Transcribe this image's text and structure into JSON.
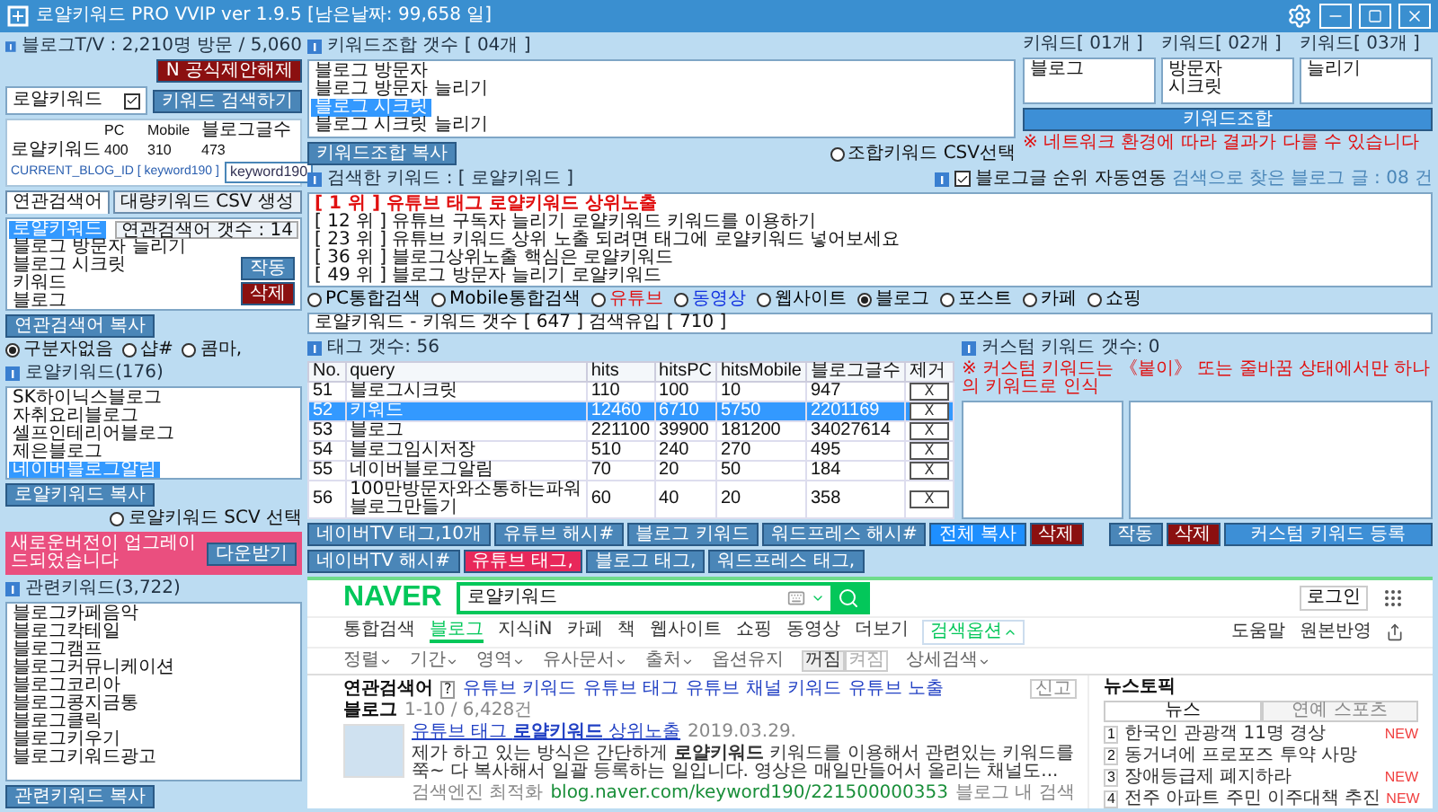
{
  "window": {
    "title": "로얄키워드 PRO VVIP ver 1.9.5 [남은날짜: 99,658 일]"
  },
  "blog_stats": {
    "label": "블로그T/V : 2,210명 방문 / 5,060",
    "button": "N 공식제안해제"
  },
  "search": {
    "value": "로얄키워드",
    "checked": true,
    "button": "키워드 검색하기"
  },
  "stats": {
    "columns": [
      "PC",
      "Mobile",
      "블로그글수"
    ],
    "keyword": "로얄키워드",
    "values": [
      "400",
      "310",
      "473"
    ],
    "blog_id_label": "CURRENT_BLOG_ID [ keyword190 ]",
    "blog_id_value": "keyword190"
  },
  "tabs": [
    {
      "label": "연관검색어",
      "selected": true
    },
    {
      "label": "대량키워드 CSV 생성",
      "selected": false
    }
  ],
  "related_list": {
    "count": "연관검색어 갯수 : 14",
    "items": [
      {
        "label": "로얄키워드",
        "selected": true
      },
      {
        "label": "블로그 방문자 늘리기",
        "selected": false
      },
      {
        "label": "블로그 시크릿",
        "selected": false
      },
      {
        "label": "키워드",
        "selected": false
      },
      {
        "label": "블로그",
        "selected": false
      }
    ],
    "run_button": "작동",
    "delete_button": "삭제",
    "copy_button": "연관검색어 복사",
    "separators": [
      {
        "label": "구분자없음",
        "selected": true
      },
      {
        "label": "샵#",
        "selected": false
      },
      {
        "label": "콤마,",
        "selected": false
      }
    ]
  },
  "royal": {
    "header": "로얄키워드(176)",
    "items": [
      {
        "label": "SK하이닉스블로그",
        "selected": false
      },
      {
        "label": "자취요리블로그",
        "selected": false
      },
      {
        "label": "셀프인테리어블로그",
        "selected": false
      },
      {
        "label": "제은블로그",
        "selected": false
      },
      {
        "label": "네이버블로그알림",
        "selected": true
      }
    ],
    "copy_button": "로얄키워드 복사",
    "csv_option": {
      "label": "로얄키워드 SCV 선택",
      "selected": false
    }
  },
  "banner": {
    "text": "새로운버전이 업그레이드되었습니다",
    "button": "다운받기"
  },
  "related_keywords": {
    "header": "관련키워드(3,722)",
    "items": [
      "블로그카페음악",
      "블로그칵테일",
      "블로그캠프",
      "블로그커뮤니케이션",
      "블로그코리아",
      "블로그콩지금통",
      "블로그클릭",
      "블로그키우기",
      "블로그키워드광고"
    ],
    "copy_button": "관련키워드 복사"
  },
  "combo": {
    "header": "키워드조합 갯수 [ 04개 ]",
    "items": [
      {
        "label": "블로그 방문자",
        "selected": false
      },
      {
        "label": "블로그 방문자 늘리기",
        "selected": false
      },
      {
        "label": "블로그 시크릿",
        "selected": true
      },
      {
        "label": "블로그 시크릿 늘리기",
        "selected": false
      }
    ],
    "copy_button": "키워드조합 복사",
    "csv_option": {
      "label": "조합키워드 CSV선택",
      "selected": false
    }
  },
  "keyword_lists": [
    {
      "header": "키워드[ 01개 ]",
      "items": [
        "블로그"
      ]
    },
    {
      "header": "키워드[ 02개 ]",
      "items": [
        "방문자",
        "시크릿"
      ]
    },
    {
      "header": "키워드[ 03개 ]",
      "items": [
        "늘리기"
      ]
    }
  ],
  "combine_button": "키워드조합",
  "network_warning": "※ 네트워크 환경에 따라 결과가 다를 수 있습니다",
  "ranking": {
    "header": "검색한 키워드 : [ 로얄키워드 ]",
    "auto_link": {
      "label": "블로그글 순위 자동연동",
      "checked": true
    },
    "found": "검색으로 찾은 블로그 글 : 08 건",
    "lines": [
      {
        "text": "[ 1 위 ] 유튜브 태그 로얄키워드 상위노출",
        "highlight": true
      },
      {
        "text": "[ 12 위 ] 유튜브 구독자 늘리기 로얄키워드 키워드를 이용하기",
        "highlight": false
      },
      {
        "text": "[ 23 위 ] 유튜브 키워드 상위 노출 되려면 태그에 로얄키워드 넣어보세요",
        "highlight": false
      },
      {
        "text": "[ 36 위 ] 블로그상위노출 핵심은 로얄키워드",
        "highlight": false
      },
      {
        "text": "[ 49 위 ] 블로그 방문자 늘리기 로얄키워드",
        "highlight": false
      }
    ]
  },
  "search_types": [
    {
      "label": "PC통합검색",
      "selected": false,
      "color": "#000000"
    },
    {
      "label": "Mobile통합검색",
      "selected": false,
      "color": "#000000"
    },
    {
      "label": "유튜브",
      "selected": false,
      "color": "#e01010"
    },
    {
      "label": "동영상",
      "selected": false,
      "color": "#1030e0"
    },
    {
      "label": "웹사이트",
      "selected": false,
      "color": "#000000"
    },
    {
      "label": "블로그",
      "selected": true,
      "color": "#000000"
    },
    {
      "label": "포스트",
      "selected": false,
      "color": "#000000"
    },
    {
      "label": "카페",
      "selected": false,
      "color": "#000000"
    },
    {
      "label": "쇼핑",
      "selected": false,
      "color": "#000000"
    }
  ],
  "summary": "로얄키워드 - 키워드 갯수 [ 647 ] 검색유입 [ 710 ]",
  "tags": {
    "header": "태그 갯수: 56",
    "columns": [
      "No.",
      "query",
      "hits",
      "hitsPC",
      "hitsMobile",
      "블로그글수",
      "제거"
    ],
    "rows": [
      {
        "cells": [
          "51",
          "블로그시크릿",
          "110",
          "100",
          "10",
          "947"
        ],
        "remove": "X",
        "selected": false
      },
      {
        "cells": [
          "52",
          "키워드",
          "12460",
          "6710",
          "5750",
          "2201169"
        ],
        "remove": "X",
        "selected": true
      },
      {
        "cells": [
          "53",
          "블로그",
          "221100",
          "39900",
          "181200",
          "34027614"
        ],
        "remove": "X",
        "selected": false
      },
      {
        "cells": [
          "54",
          "블로그임시저장",
          "510",
          "240",
          "270",
          "495"
        ],
        "remove": "X",
        "selected": false
      },
      {
        "cells": [
          "55",
          "네이버블로그알림",
          "70",
          "20",
          "50",
          "184"
        ],
        "remove": "X",
        "selected": false
      },
      {
        "cells": [
          "56",
          "100만방문자와소통하는파워블로그만들기",
          "60",
          "40",
          "20",
          "358"
        ],
        "remove": "X",
        "selected": false
      }
    ]
  },
  "custom": {
    "header": "커스텀 키워드 갯수: 0",
    "warning": "※ 커스텀 키워드는 《붙이》 또는 줄바꿈 상태에서만 하나의 키워드로 인식"
  },
  "tag_buttons": [
    [
      {
        "label": "네이버TV 태그,10개",
        "kind": "primary"
      },
      {
        "label": "유튜브 해시#",
        "kind": "primary"
      },
      {
        "label": "블로그 키워드",
        "kind": "primary"
      },
      {
        "label": "워드프레스 해시#",
        "kind": "primary"
      },
      {
        "label": "전체 복사",
        "kind": "bright"
      },
      {
        "label": "삭제",
        "kind": "danger"
      }
    ],
    [
      {
        "label": "네이버TV 해시#",
        "kind": "primary"
      },
      {
        "label": "유튜브 태그,",
        "kind": "accent"
      },
      {
        "label": "블로그 태그,",
        "kind": "primary"
      },
      {
        "label": "워드프레스 태그,",
        "kind": "primary"
      }
    ]
  ],
  "custom_buttons": [
    {
      "label": "작동",
      "kind": "primary"
    },
    {
      "label": "삭제",
      "kind": "danger"
    },
    {
      "label": "커스텀 키워드 등록",
      "kind": "wide"
    }
  ],
  "naver": {
    "logo": "NAVER",
    "query": "로얄키워드",
    "login": "로그인",
    "nav": [
      {
        "label": "통합검색",
        "selected": false
      },
      {
        "label": "블로그",
        "selected": true
      },
      {
        "label": "지식iN",
        "selected": false
      },
      {
        "label": "카페",
        "selected": false
      },
      {
        "label": "책",
        "selected": false
      },
      {
        "label": "웹사이트",
        "selected": false
      },
      {
        "label": "쇼핑",
        "selected": false
      },
      {
        "label": "동영상",
        "selected": false
      },
      {
        "label": "더보기",
        "selected": false
      }
    ],
    "options_button": "검색옵션",
    "nav_right": [
      "도움말",
      "원본반영"
    ],
    "filters": [
      "정렬",
      "기간",
      "영역",
      "유사문서",
      "출처"
    ],
    "option_keep": {
      "label": "옵션유지",
      "states": [
        {
          "label": "꺼짐",
          "selected": true
        },
        {
          "label": "켜짐",
          "selected": false
        }
      ]
    },
    "detail": "상세검색",
    "related": {
      "label": "연관검색어",
      "help": "?",
      "items": [
        "유튜브 키워드",
        "유튜브 태그",
        "유튜브 채널 키워드",
        "유튜브 노출"
      ],
      "report": "신고"
    },
    "section": {
      "title": "블로그",
      "count": "1-10 / 6,428건"
    },
    "results": [
      {
        "title": "유튜브 태그 **로얄키워드** 상위노출",
        "date": "2019.03.29.",
        "snippet": "제가 하고 있는 방식은 간단하게 **로얄키워드** 키워드를 이용해서 관련있는 키워드를 쭉~ 다 복사해서 일괄 등록하는 일입니다. 영상은 매일만들어서 올리는 채널도...",
        "source": "검색엔진 최적화",
        "url": "blog.naver.com/keyword190/221500000353",
        "inner": "블로그 내 검색"
      }
    ],
    "news": {
      "title": "뉴스토픽",
      "tabs": [
        {
          "label": "뉴스",
          "selected": true
        },
        {
          "label": "연예 스포츠",
          "selected": false
        }
      ],
      "items": [
        {
          "rank": "1",
          "text": "한국인 관광객 11명 경상",
          "badge": "NEW"
        },
        {
          "rank": "2",
          "text": "동거녀에 프로포즈 투약 사망"
        },
        {
          "rank": "3",
          "text": "장애등급제 폐지하라",
          "badge": "NEW"
        },
        {
          "rank": "4",
          "text": "전주 아파트 주민 이주대책 추진",
          "badge": "NEW"
        }
      ]
    }
  }
}
